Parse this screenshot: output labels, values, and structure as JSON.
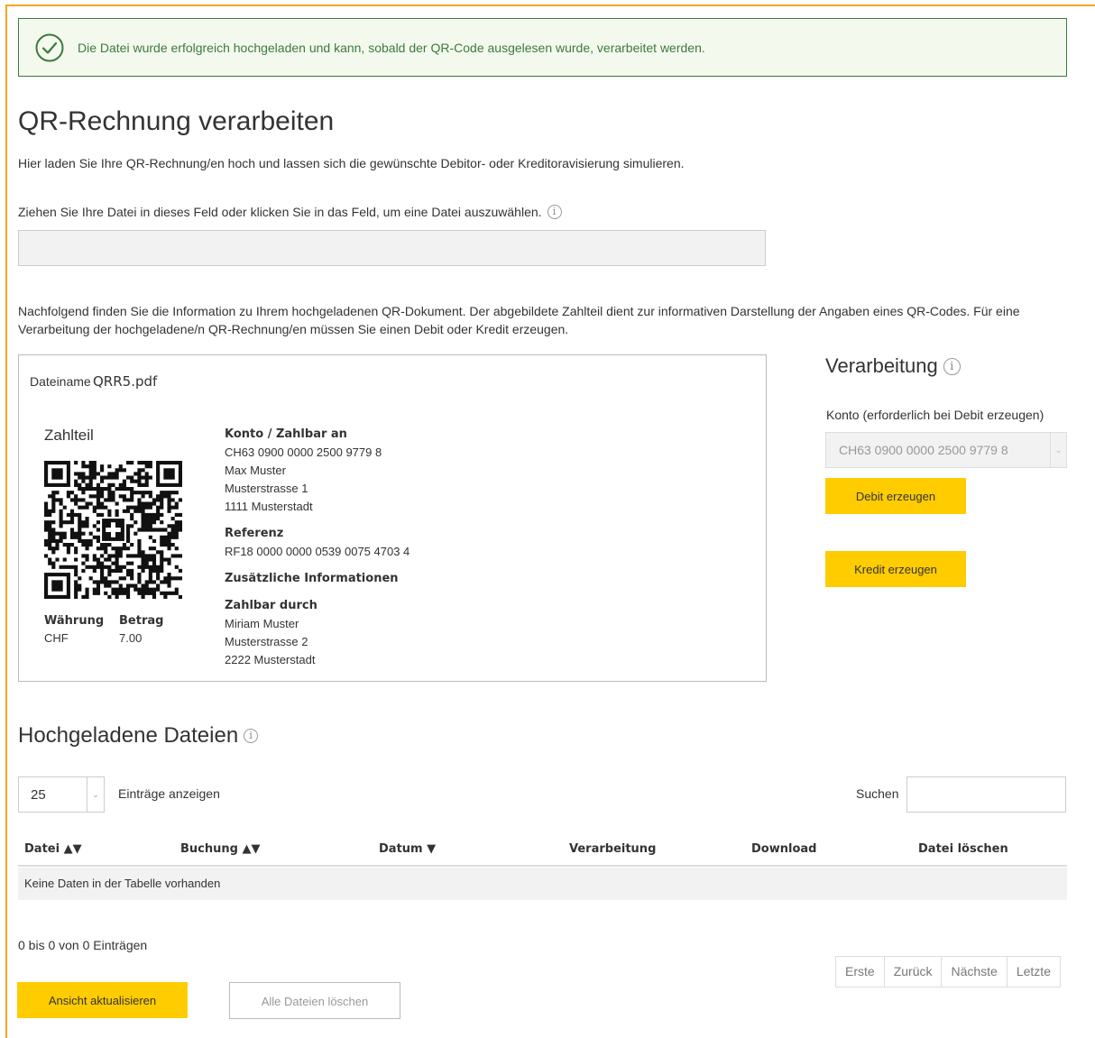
{
  "alert": {
    "message": "Die Datei wurde erfolgreich hochgeladen und kann, sobald der QR-Code ausgelesen wurde, verarbeitet werden.",
    "color": "#3c7a3c"
  },
  "page": {
    "title": "QR-Rechnung verarbeiten",
    "intro": "Hier laden Sie Ihre QR-Rechnung/en hoch und lassen sich die gewünschte Debitor- oder Kreditoravisierung simulieren.",
    "drop_label": "Ziehen Sie Ihre Datei in dieses Feld oder klicken Sie in das Feld, um eine Datei auszuwählen.",
    "description": "Nachfolgend finden Sie die Information zu Ihrem hochgeladenen QR-Dokument. Der abgebildete Zahlteil dient zur informativen Darstellung der Angaben eines QR-Codes. Für eine Verarbeitung der hochgeladene/n QR-Rechnung/en müssen Sie einen Debit oder Kredit erzeugen."
  },
  "document": {
    "filename_label": "Dateiname",
    "filename": "QRR5.pdf",
    "zahlteil_label": "Zahlteil",
    "currency_label": "Währung",
    "amount_label": "Betrag",
    "currency": "CHF",
    "amount": "7.00",
    "account_label": "Konto / Zahlbar an",
    "account_lines": [
      "CH63 0900 0000 2500 9779 8",
      "Max Muster",
      "Musterstrasse 1",
      "1111 Musterstadt"
    ],
    "reference_label": "Referenz",
    "reference": "RF18 0000 0000 0539 0075 4703 4",
    "additional_label": "Zusätzliche Informationen",
    "payer_label": "Zahlbar durch",
    "payer_lines": [
      "Miriam Muster",
      "Musterstrasse 2",
      "2222 Musterstadt"
    ]
  },
  "processing": {
    "title": "Verarbeitung",
    "account_label": "Konto (erforderlich bei Debit erzeugen)",
    "account_value": "CH63 0900 0000 2500 9779 8",
    "debit_button": "Debit erzeugen",
    "credit_button": "Kredit erzeugen",
    "accent": "#ffcc00"
  },
  "files": {
    "title": "Hochgeladene Dateien",
    "page_length": "25",
    "page_length_label": "Einträge anzeigen",
    "search_label": "Suchen",
    "columns": [
      "Datei ▲▼",
      "Buchung ▲▼",
      "Datum ▼",
      "Verarbeitung",
      "Download",
      "Datei löschen"
    ],
    "empty_message": "Keine Daten in der Tabelle vorhanden",
    "info": "0 bis 0 von 0 Einträgen",
    "pager": [
      "Erste",
      "Zurück",
      "Nächste",
      "Letzte"
    ],
    "refresh_button": "Ansicht aktualisieren",
    "delete_all_button": "Alle Dateien löschen"
  }
}
